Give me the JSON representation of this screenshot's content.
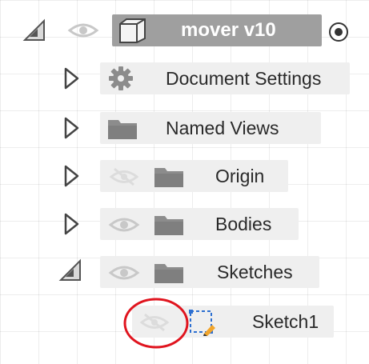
{
  "browser": {
    "root": {
      "label": "mover v10",
      "expanded": true,
      "icons": {
        "toggle": "collapse-triangle-icon",
        "visibility": "eye-icon",
        "type": "component-cube-icon",
        "activate": "radio-active-icon"
      }
    },
    "items": [
      {
        "label": "Document Settings",
        "expanded": false,
        "icon": "gear-icon",
        "visible": null
      },
      {
        "label": "Named Views",
        "expanded": false,
        "icon": "folder-icon",
        "visible": null
      },
      {
        "label": "Origin",
        "expanded": false,
        "icon": "folder-icon",
        "visible": false
      },
      {
        "label": "Bodies",
        "expanded": false,
        "icon": "folder-icon",
        "visible": true
      },
      {
        "label": "Sketches",
        "expanded": true,
        "icon": "folder-icon",
        "visible": true
      },
      {
        "label": "Sketch1",
        "icon": "sketch-icon",
        "visible": false,
        "highlighted": true
      }
    ]
  },
  "colors": {
    "highlight_circle": "#e0141e",
    "pill": "#efefef",
    "root_pill": "#9f9f9f",
    "icon_gray": "#8c8c8c"
  }
}
